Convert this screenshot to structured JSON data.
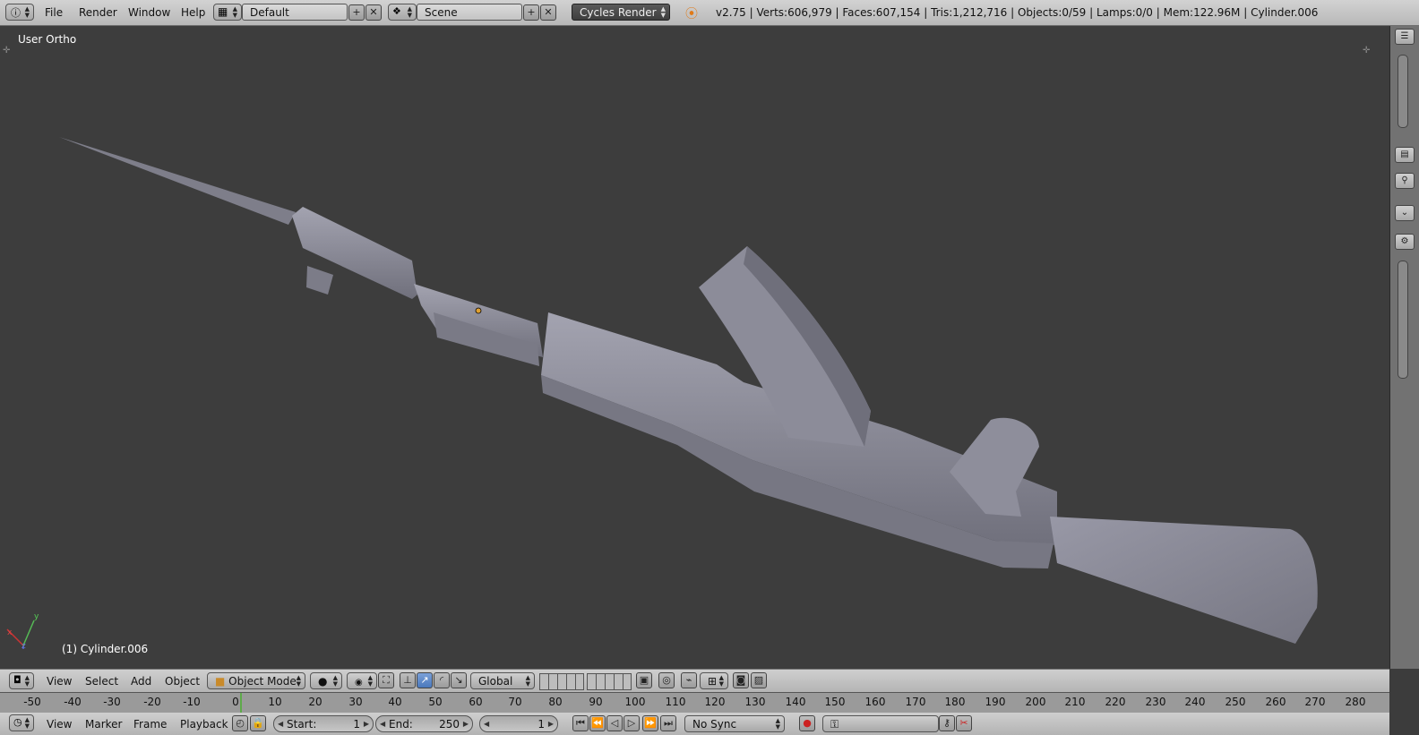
{
  "menu": {
    "info_icon": "info-icon",
    "file": "File",
    "render": "Render",
    "window": "Window",
    "help": "Help"
  },
  "screen_layout": "Default",
  "scene": "Scene",
  "render_engine": "Cycles Render",
  "stats": "v2.75 | Verts:606,979 | Faces:607,154 | Tris:1,212,716 | Objects:0/59 | Lamps:0/0 | Mem:122.96M | Cylinder.006",
  "viewport": {
    "view_label": "User Ortho",
    "object_label": "(1) Cylinder.006",
    "axis_x": "x",
    "axis_y": "y",
    "axis_z": "z"
  },
  "view3d_header": {
    "view": "View",
    "select": "Select",
    "add": "Add",
    "object": "Object",
    "mode": "Object Mode",
    "orientation": "Global"
  },
  "timeline": {
    "ticks": [
      "-50",
      "-40",
      "-30",
      "-20",
      "-10",
      "0",
      "10",
      "20",
      "30",
      "40",
      "50",
      "60",
      "70",
      "80",
      "90",
      "100",
      "110",
      "120",
      "130",
      "140",
      "150",
      "160",
      "170",
      "180",
      "190",
      "200",
      "210",
      "220",
      "230",
      "240",
      "250",
      "260",
      "270",
      "280"
    ],
    "view": "View",
    "marker": "Marker",
    "frame": "Frame",
    "playback": "Playback",
    "start_label": "Start:",
    "start_value": "1",
    "end_label": "End:",
    "end_value": "250",
    "current_frame": "1",
    "sync": "No Sync"
  },
  "colors": {
    "viewport_bg": "#3d3d3d",
    "model": "#8d8d99",
    "current_frame_marker": "#5eaa4a"
  }
}
